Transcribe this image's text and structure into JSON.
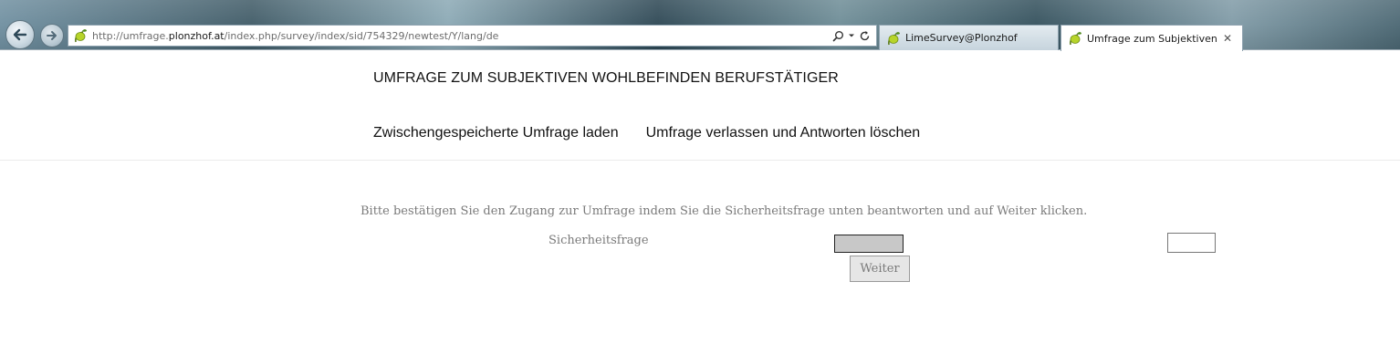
{
  "browser": {
    "url_prefix": "http://umfrage.",
    "url_host": "plonzhof.at",
    "url_path": "/index.php/survey/index/sid/754329/newtest/Y/lang/de",
    "tabs": [
      {
        "label": "LimeSurvey@Plonzhof",
        "active": false
      },
      {
        "label": "Umfrage zum Subjektiven ...",
        "active": true,
        "close": "✕"
      }
    ]
  },
  "survey": {
    "title": "UMFRAGE ZUM SUBJEKTIVEN WOHLBEFINDEN BERUFSTÄTIGER",
    "nav": {
      "load_label": "Zwischengespeicherte Umfrage laden",
      "exit_label": "Umfrage verlassen und Antworten löschen"
    },
    "instruction": "Bitte bestätigen Sie den Zugang zur Umfrage indem Sie die Sicherheitsfrage unten beantworten und auf Weiter klicken.",
    "captcha_label": "Sicherheitsfrage",
    "captcha_value": "",
    "submit_label": "Weiter"
  },
  "colors": {
    "text_muted": "#7a7a7a",
    "title": "#111111",
    "button_bg": "#e6e6e6"
  },
  "icons": [
    "back-arrow-icon",
    "forward-arrow-icon",
    "lime-favicon-icon",
    "search-icon",
    "dropdown-icon",
    "refresh-icon",
    "close-icon"
  ]
}
